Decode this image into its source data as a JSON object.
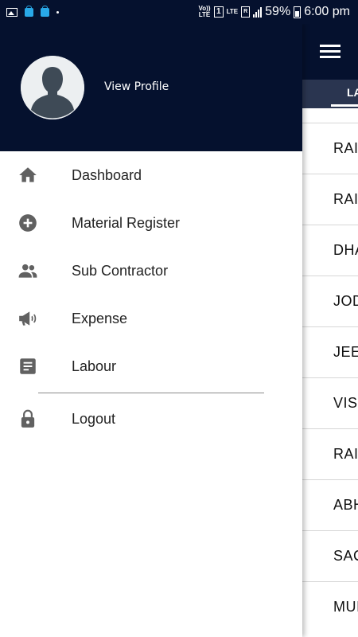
{
  "status_bar": {
    "volte": "Vo)) LTE",
    "sim": "1",
    "lte": "LTE",
    "r": "R",
    "battery_percent": "59%",
    "time": "6:00 pm"
  },
  "app": {
    "tab_label": "LA",
    "list_items": [
      "RAI",
      "RAI",
      "DHA",
      "JOD",
      "JEE",
      "VIS",
      "RAI",
      "ABH",
      "SAC",
      "MUI"
    ]
  },
  "drawer": {
    "view_profile": "View Profile",
    "menu": [
      {
        "label": "Dashboard",
        "icon": "home-icon"
      },
      {
        "label": "Material Register",
        "icon": "add-circle-icon"
      },
      {
        "label": "Sub Contractor",
        "icon": "people-icon"
      },
      {
        "label": "Expense",
        "icon": "megaphone-icon"
      },
      {
        "label": "Labour",
        "icon": "document-icon"
      }
    ],
    "logout": {
      "label": "Logout",
      "icon": "lock-icon"
    }
  },
  "colors": {
    "header_bg": "#05112e",
    "icon_gray": "#616161",
    "status_icon_blue": "#29a9e8"
  }
}
